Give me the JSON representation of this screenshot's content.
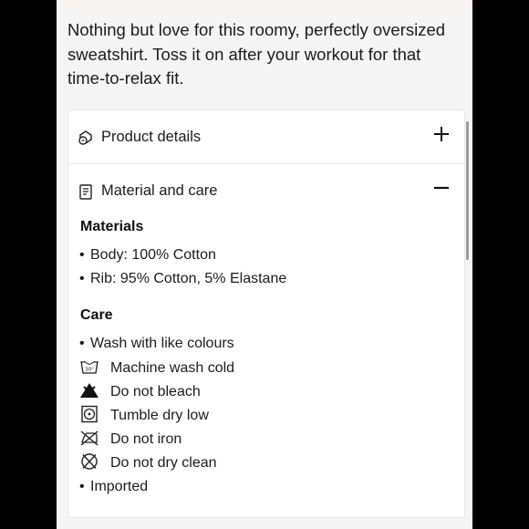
{
  "description": "Nothing but love for this roomy, perfectly oversized sweatshirt. Toss it on after your workout for that time-to-relax fit.",
  "accordion": {
    "product_details": {
      "label": "Product details",
      "icon": "product-details-icon",
      "state": "collapsed"
    },
    "material_care": {
      "label": "Material and care",
      "icon": "care-label-icon",
      "state": "expanded"
    }
  },
  "materials": {
    "title": "Materials",
    "items": [
      "Body: 100% Cotton",
      "Rib: 95% Cotton, 5% Elastane"
    ]
  },
  "care": {
    "title": "Care",
    "items": [
      {
        "text": "Wash with like colours",
        "icon": "bullet"
      },
      {
        "text": "Machine wash cold",
        "icon": "machine-wash-cold-icon"
      },
      {
        "text": "Do not bleach",
        "icon": "do-not-bleach-icon"
      },
      {
        "text": "Tumble dry low",
        "icon": "tumble-dry-low-icon"
      },
      {
        "text": "Do not iron",
        "icon": "do-not-iron-icon"
      },
      {
        "text": "Do not dry clean",
        "icon": "do-not-dry-clean-icon"
      },
      {
        "text": "Imported",
        "icon": "bullet"
      }
    ]
  },
  "colors": {
    "text": "#1c1c1c",
    "background": "#f5f5f5",
    "card": "#ffffff"
  }
}
